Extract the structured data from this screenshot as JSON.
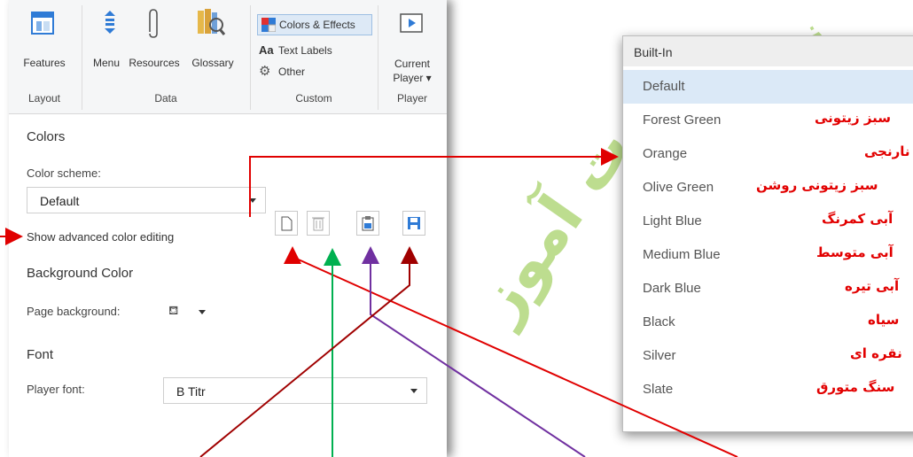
{
  "ribbon": {
    "features_label": "Features",
    "menu_label": "Menu",
    "resources_label": "Resources",
    "glossary_label": "Glossary",
    "colors_effects_label": "Colors & Effects",
    "text_labels_label": "Text Labels",
    "other_label": "Other",
    "current_player_line1": "Current",
    "current_player_line2": "Player",
    "groups": {
      "layout": "Layout",
      "data": "Data",
      "custom": "Custom",
      "player": "Player"
    }
  },
  "colors": {
    "section_title": "Colors",
    "scheme_label": "Color scheme:",
    "scheme_value": "Default",
    "advanced_link": "Show advanced color editing"
  },
  "background": {
    "section_title": "Background Color",
    "page_bg_label": "Page background:"
  },
  "font": {
    "section_title": "Font",
    "player_font_label": "Player font:",
    "player_font_value": "B Titr"
  },
  "dropdown_list": {
    "header": "Built-In",
    "items": [
      {
        "en": "Default",
        "fa": ""
      },
      {
        "en": "Forest Green",
        "fa": "سبز زیتونی"
      },
      {
        "en": "Orange",
        "fa": "نارنجی"
      },
      {
        "en": "Olive Green",
        "fa": "سبز زیتونی روشن"
      },
      {
        "en": "Light Blue",
        "fa": "آبی کمرنگ"
      },
      {
        "en": "Medium Blue",
        "fa": "آبی متوسط"
      },
      {
        "en": "Dark Blue",
        "fa": "آبی تیره"
      },
      {
        "en": "Black",
        "fa": "سیاه"
      },
      {
        "en": "Silver",
        "fa": "نقره ای"
      },
      {
        "en": "Slate",
        "fa": "سنگ متورق"
      }
    ]
  },
  "watermark": {
    "text1": "ت آموز",
    "text2": "ز"
  },
  "colors_palette": {
    "accent_blue": "#1f6fd0",
    "arrow_red": "#e00000",
    "arrow_darkred": "#a00000",
    "arrow_green": "#00b050",
    "arrow_purple": "#7030a0",
    "selected_item_bg": "#dbe9f7"
  }
}
